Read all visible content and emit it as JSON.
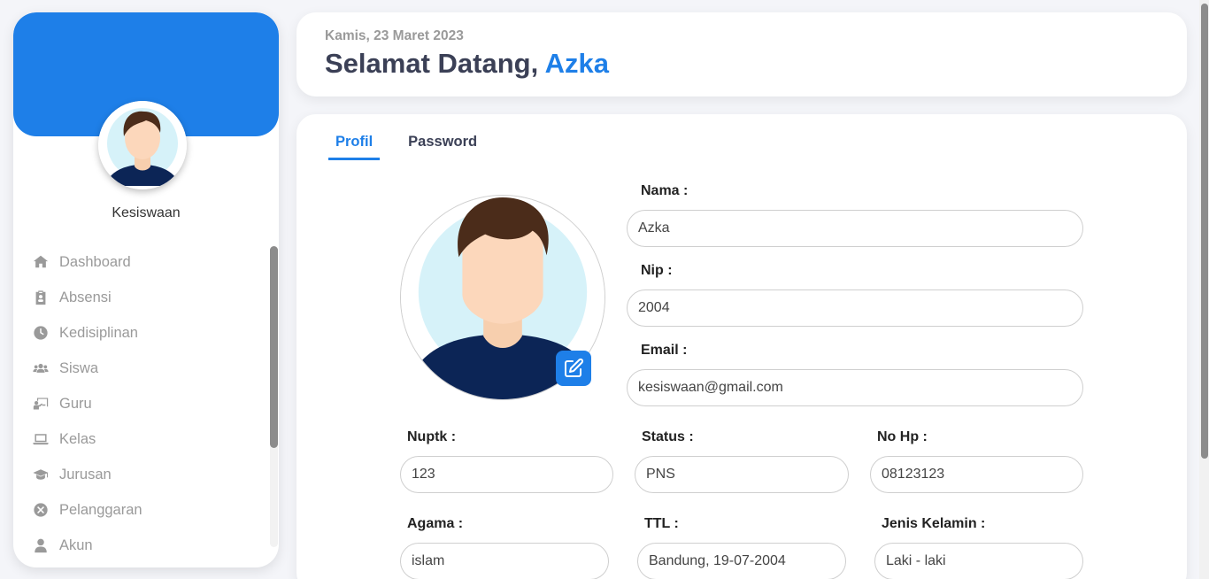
{
  "colors": {
    "accent": "#1e7fe8",
    "title": "#3b4056",
    "muted": "#9a9a9a"
  },
  "sidebar": {
    "role": "Kesiswaan",
    "items": [
      {
        "label": "Dashboard",
        "icon": "home-icon"
      },
      {
        "label": "Absensi",
        "icon": "clipboard-icon"
      },
      {
        "label": "Kedisiplinan",
        "icon": "clock-icon"
      },
      {
        "label": "Siswa",
        "icon": "users-icon"
      },
      {
        "label": "Guru",
        "icon": "chalkboard-teacher-icon"
      },
      {
        "label": "Kelas",
        "icon": "laptop-icon"
      },
      {
        "label": "Jurusan",
        "icon": "graduation-cap-icon"
      },
      {
        "label": "Pelanggaran",
        "icon": "x-circle-icon"
      },
      {
        "label": "Akun",
        "icon": "user-icon"
      }
    ]
  },
  "header": {
    "date": "Kamis, 23 Maret 2023",
    "greeting": "Selamat Datang,",
    "name": "Azka"
  },
  "tabs": [
    {
      "label": "Profil",
      "active": true
    },
    {
      "label": "Password",
      "active": false
    }
  ],
  "form": {
    "nama": {
      "label": "Nama :",
      "value": "Azka"
    },
    "nip": {
      "label": "Nip :",
      "value": "2004"
    },
    "email": {
      "label": "Email :",
      "value": "kesiswaan@gmail.com"
    },
    "nuptk": {
      "label": "Nuptk :",
      "value": "123"
    },
    "status": {
      "label": "Status :",
      "value": "PNS"
    },
    "nohp": {
      "label": "No Hp :",
      "value": "08123123"
    },
    "agama": {
      "label": "Agama :",
      "value": "islam"
    },
    "ttl": {
      "label": "TTL :",
      "value": "Bandung, 19-07-2004"
    },
    "jenis_kelamin": {
      "label": "Jenis Kelamin :",
      "value": "Laki - laki"
    }
  }
}
